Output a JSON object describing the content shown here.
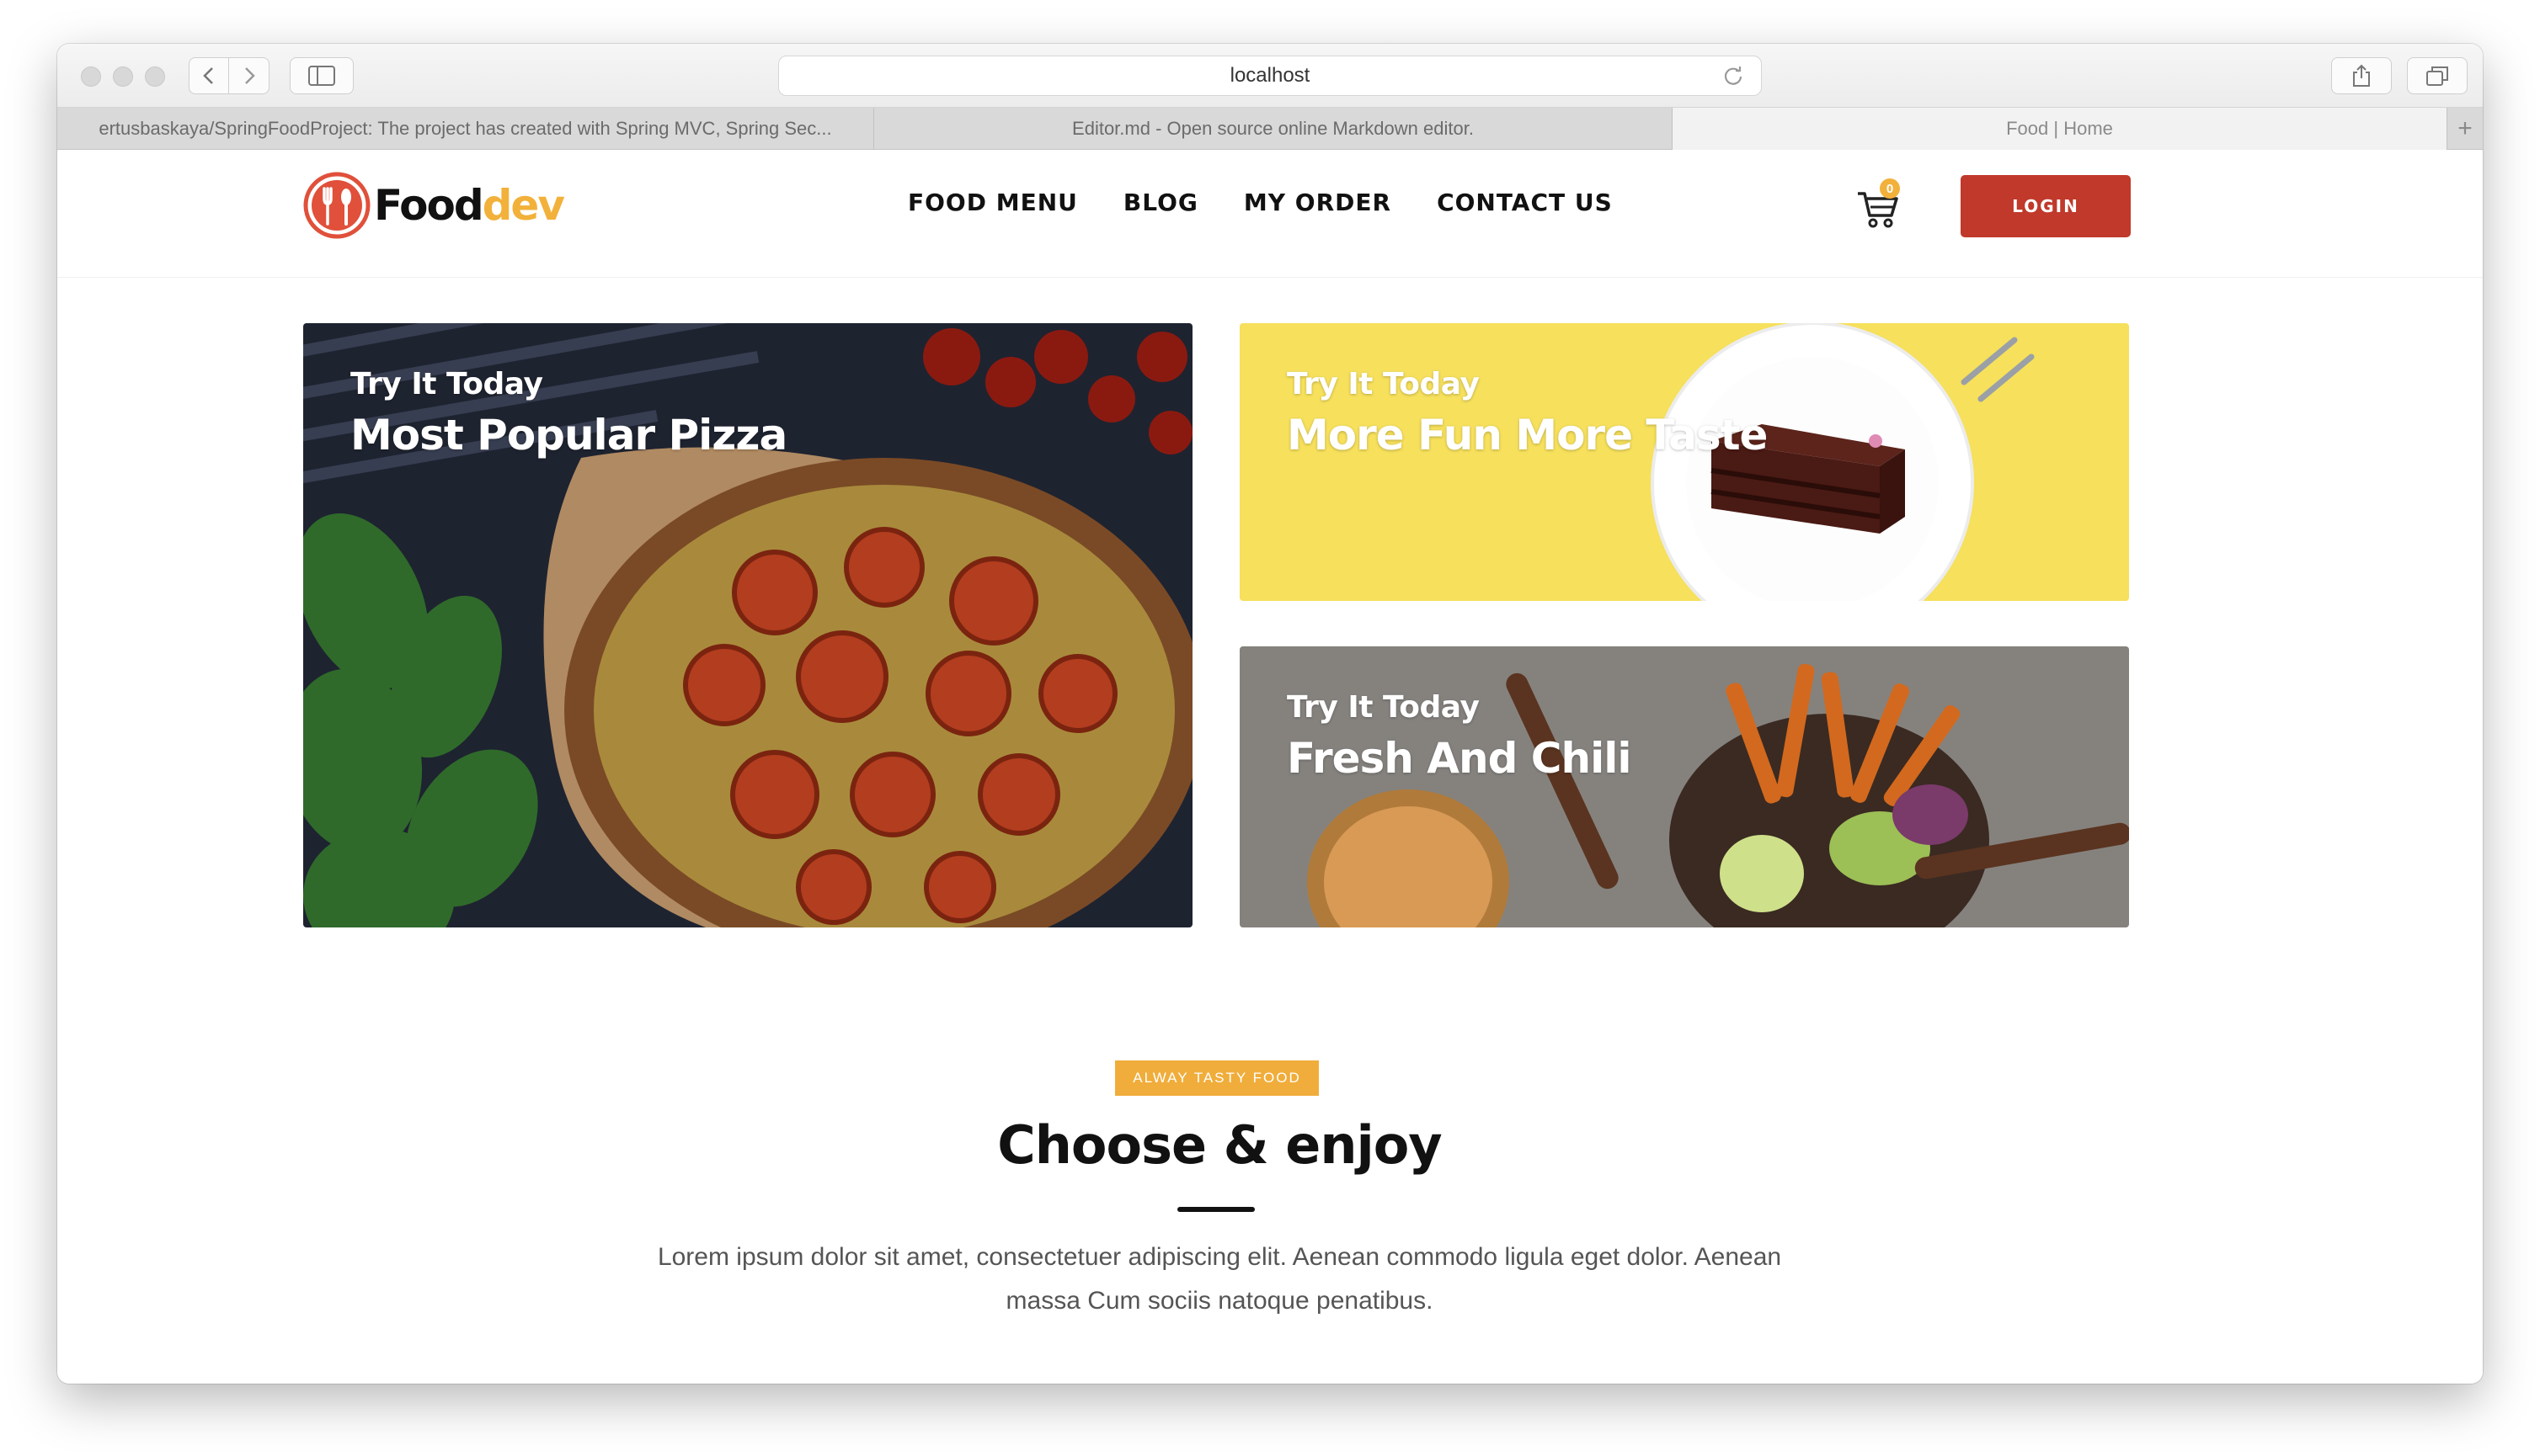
{
  "browser": {
    "url": "localhost",
    "tabs": [
      {
        "label": "ertusbaskaya/SpringFoodProject: The project has created with Spring MVC, Spring Sec..."
      },
      {
        "label": "Editor.md - Open source online Markdown editor."
      },
      {
        "label": "Food | Home"
      }
    ]
  },
  "site": {
    "logo": {
      "part1": "Food",
      "part2": "dev"
    },
    "nav": [
      "FOOD MENU",
      "BLOG",
      "MY ORDER",
      "CONTACT US"
    ],
    "cart_count": "0",
    "login_label": "LOGIN"
  },
  "banners": [
    {
      "kicker": "Try It Today",
      "title": "Most Popular Pizza"
    },
    {
      "kicker": "Try It Today",
      "title": "More Fun More Taste"
    },
    {
      "kicker": "Try It Today",
      "title": "Fresh And Chili"
    }
  ],
  "section": {
    "tag": "ALWAY TASTY FOOD",
    "title": "Choose & enjoy",
    "description_line1": "Lorem ipsum dolor sit amet, consectetuer adipiscing elit. Aenean commodo ligula eget dolor. Aenean",
    "description_line2": "massa Cum sociis natoque penatibus."
  },
  "colors": {
    "brand_red": "#c0392b",
    "brand_yellow": "#f2b13a",
    "cake_banner_bg": "#f6e05c"
  },
  "category_icons": [
    "burger-icon",
    "pizza-icon",
    "salad-icon",
    "drink-icon",
    "dessert-icon"
  ]
}
